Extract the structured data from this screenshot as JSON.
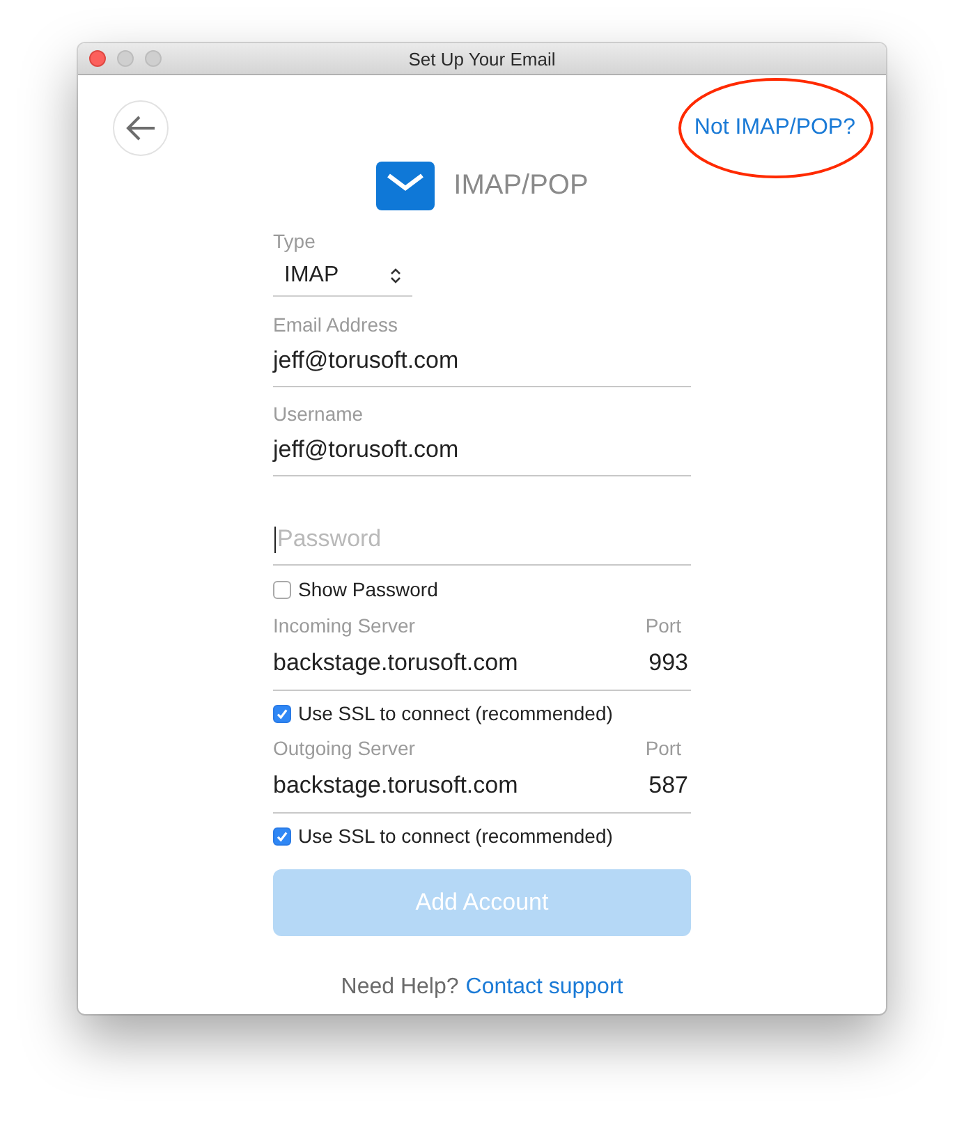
{
  "window": {
    "title": "Set Up Your Email"
  },
  "top_bar": {
    "switch_link": "Not IMAP/POP?",
    "highlight": {
      "kind": "ellipse",
      "color": "#ff2a00"
    }
  },
  "header": {
    "title": "IMAP/POP"
  },
  "form": {
    "type": {
      "label": "Type",
      "value": "IMAP"
    },
    "email": {
      "label": "Email Address",
      "value": "jeff@torusoft.com"
    },
    "username": {
      "label": "Username",
      "value": "jeff@torusoft.com"
    },
    "password": {
      "placeholder": "Password",
      "focused": true
    },
    "show_password": {
      "label": "Show Password",
      "checked": false
    },
    "incoming": {
      "label": "Incoming Server",
      "port_label": "Port",
      "server": "backstage.torusoft.com",
      "port": "993",
      "ssl": {
        "label": "Use SSL to connect (recommended)",
        "checked": true
      }
    },
    "outgoing": {
      "label": "Outgoing Server",
      "port_label": "Port",
      "server": "backstage.torusoft.com",
      "port": "587",
      "ssl": {
        "label": "Use SSL to connect (recommended)",
        "checked": true
      }
    },
    "submit": {
      "label": "Add Account",
      "disabled": true
    }
  },
  "help": {
    "text": "Need Help?",
    "link": "Contact support"
  }
}
